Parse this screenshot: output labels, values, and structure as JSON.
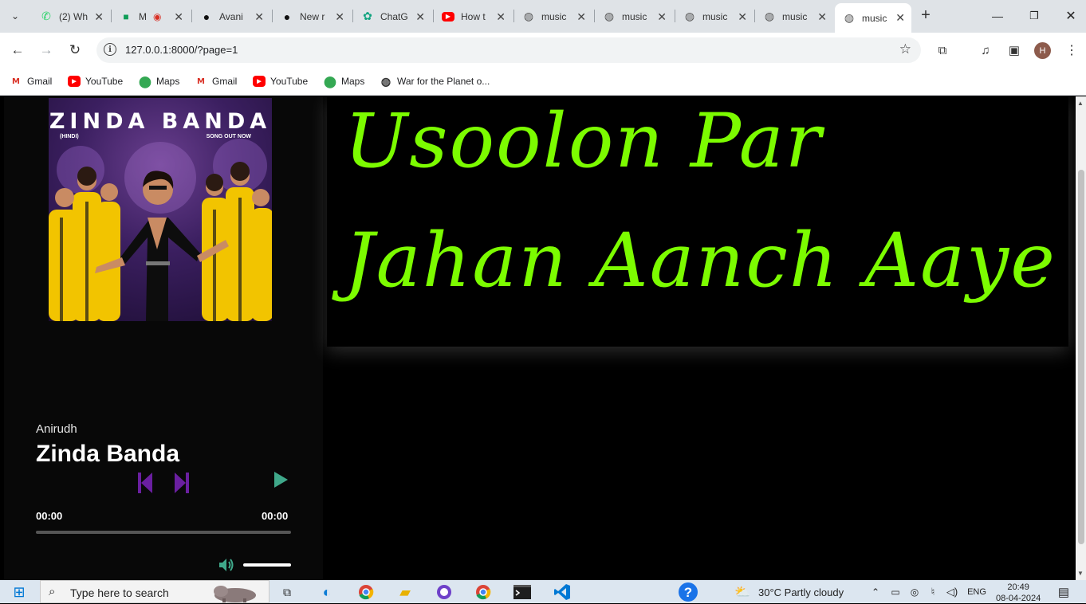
{
  "browser": {
    "tabs": [
      {
        "label": "(2) Wh",
        "icon": "whatsapp-icon",
        "active": false
      },
      {
        "label": "M",
        "icon": "meet-icon",
        "active": false
      },
      {
        "label": "Avani",
        "icon": "github-icon",
        "active": false
      },
      {
        "label": "New r",
        "icon": "github-icon",
        "active": false
      },
      {
        "label": "ChatG",
        "icon": "chatgpt-icon",
        "active": false
      },
      {
        "label": "How t",
        "icon": "youtube-icon",
        "active": false
      },
      {
        "label": "music",
        "icon": "globe-icon",
        "active": false
      },
      {
        "label": "music",
        "icon": "globe-icon",
        "active": false
      },
      {
        "label": "music",
        "icon": "globe-icon",
        "active": false
      },
      {
        "label": "music",
        "icon": "globe-icon",
        "active": false
      },
      {
        "label": "music",
        "icon": "globe-icon",
        "active": true
      }
    ],
    "url": "127.0.0.1:8000/?page=1",
    "avatar_letter": "H",
    "bookmarks": [
      {
        "label": "Gmail",
        "icon": "gmail-icon"
      },
      {
        "label": "YouTube",
        "icon": "youtube-icon"
      },
      {
        "label": "Maps",
        "icon": "maps-icon"
      },
      {
        "label": "Gmail",
        "icon": "gmail-icon"
      },
      {
        "label": "YouTube",
        "icon": "youtube-icon"
      },
      {
        "label": "Maps",
        "icon": "maps-icon"
      },
      {
        "label": "War for the Planet o...",
        "icon": "globe-icon"
      }
    ]
  },
  "player": {
    "cover": {
      "title": "ZINDA BANDA",
      "left_tag": "(HINDI)",
      "right_tag": "SONG OUT NOW"
    },
    "artist": "Anirudh",
    "song": "Zinda Banda",
    "current_time": "00:00",
    "total_time": "00:00",
    "progress": 0,
    "volume": 1,
    "colors": {
      "skip": "#6a1fa0",
      "play": "#3fa88a",
      "volume_icon": "#3fa88a"
    }
  },
  "lyrics": {
    "text": "Usoolon Par Jahan Aanch Aaye",
    "color": "#7cfc00"
  },
  "taskbar": {
    "search_placeholder": "Type here to search",
    "weather": "30°C  Partly cloudy",
    "language": "ENG",
    "time": "20:49",
    "date": "08-04-2024"
  }
}
